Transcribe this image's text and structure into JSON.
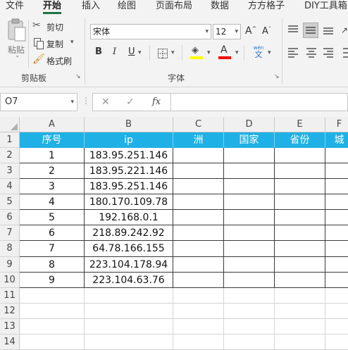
{
  "ribbon": {
    "tabs": [
      "文件",
      "开始",
      "插入",
      "绘图",
      "页面布局",
      "数据",
      "方方格子",
      "DIY工具箱"
    ],
    "active_tab": "开始",
    "clipboard": {
      "paste": "粘贴",
      "cut": "剪切",
      "copy": "复制",
      "format_painter": "格式刷",
      "group_label": "剪贴板"
    },
    "font": {
      "name": "宋体",
      "size": "12",
      "bold": "B",
      "italic": "I",
      "underline": "U",
      "font_color_letter": "A",
      "phonetic_top": "wén",
      "phonetic_bottom": "文",
      "grow": "A",
      "shrink": "A",
      "group_label": "字体",
      "fill_color": "#ffff00",
      "font_color": "#ff0000"
    }
  },
  "formula_bar": {
    "name_box": "O7",
    "cancel": "✕",
    "enter": "✓",
    "fx": "fx",
    "content": ""
  },
  "sheet": {
    "columns": [
      "A",
      "B",
      "C",
      "D",
      "E",
      "F"
    ],
    "rows": [
      "1",
      "2",
      "3",
      "4",
      "5",
      "6",
      "7",
      "8",
      "9",
      "10",
      "11",
      "12",
      "13",
      "14"
    ],
    "header_row": [
      "序号",
      "ip",
      "洲",
      "国家",
      "省份",
      "城"
    ],
    "data": [
      [
        "1",
        "183.95.251.146"
      ],
      [
        "2",
        "183.95.221.146"
      ],
      [
        "3",
        "183.95.251.146"
      ],
      [
        "4",
        "180.170.109.78"
      ],
      [
        "5",
        "192.168.0.1"
      ],
      [
        "6",
        "218.89.242.92"
      ],
      [
        "7",
        "64.78.166.155"
      ],
      [
        "8",
        "223.104.178.94"
      ],
      [
        "9",
        "223.104.63.76"
      ]
    ],
    "header_fill": "#1fb0e6"
  }
}
